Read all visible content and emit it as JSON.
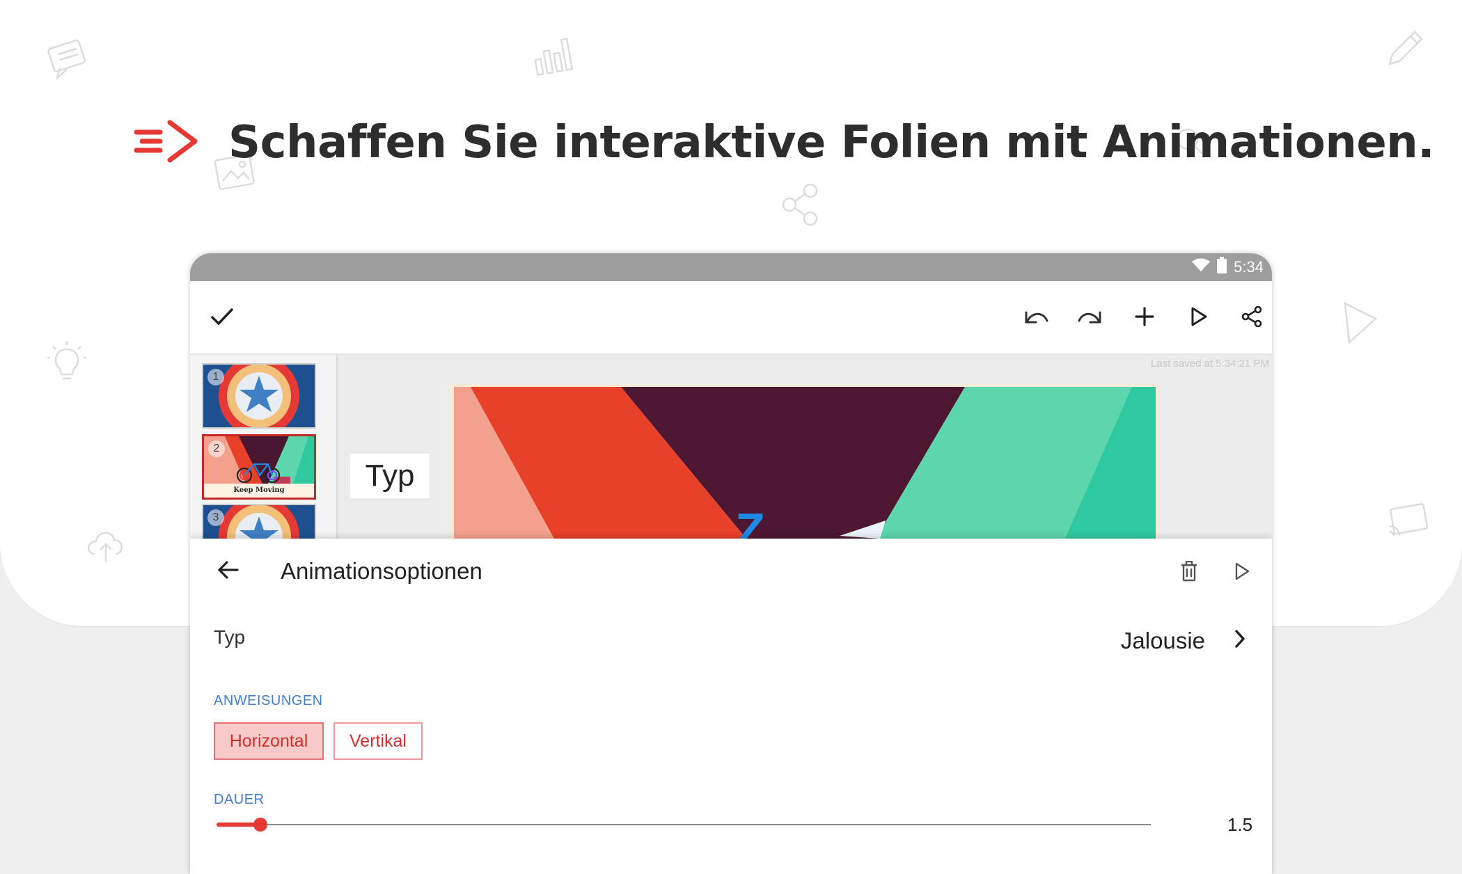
{
  "headline": {
    "text": "Schaffen Sie interaktive Folien mit Animationen."
  },
  "colors": {
    "accent": "#e53935",
    "link_blue": "#3f7fd1",
    "statusbar": "#9e9e9e"
  },
  "status_bar": {
    "time": "5:34",
    "icons": [
      "wifi-icon",
      "battery-icon"
    ]
  },
  "toolbar": {
    "left_icon": "check-icon",
    "right_icons": [
      "undo-icon",
      "redo-icon",
      "add-icon",
      "play-icon",
      "share-icon"
    ]
  },
  "workspace": {
    "last_saved": "Last saved at 5:34:21 PM",
    "typ_label": "Typ",
    "slide_glyph": "Z"
  },
  "slides": [
    {
      "number": "1",
      "caption": ""
    },
    {
      "number": "2",
      "caption": "Keep Moving"
    },
    {
      "number": "3",
      "caption": ""
    }
  ],
  "sheet": {
    "title": "Animationsoptionen",
    "type_label": "Typ",
    "type_value": "Jalousie",
    "directions_header": "ANWEISUNGEN",
    "directions": [
      {
        "label": "Horizontal",
        "active": true
      },
      {
        "label": "Vertikal",
        "active": false
      }
    ],
    "duration_header": "DAUER",
    "duration_value": "1.5",
    "duration_fraction": 0.047
  }
}
